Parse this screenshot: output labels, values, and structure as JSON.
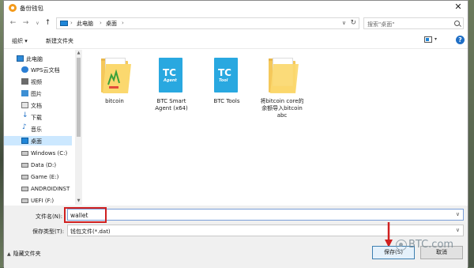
{
  "window": {
    "title": "备份钱包",
    "close_label": "✕"
  },
  "nav": {
    "breadcrumb": [
      "此电脑",
      "桌面"
    ],
    "search_placeholder": "搜索\"桌面\""
  },
  "toolbar": {
    "organize_label": "组织 ▾",
    "new_folder_label": "新建文件夹"
  },
  "sidebar": {
    "items": [
      {
        "label": "此电脑",
        "icon": "computer-icon"
      },
      {
        "label": "WPS云文档",
        "icon": "cloud-icon"
      },
      {
        "label": "视频",
        "icon": "video-icon"
      },
      {
        "label": "图片",
        "icon": "picture-icon"
      },
      {
        "label": "文档",
        "icon": "document-icon"
      },
      {
        "label": "下载",
        "icon": "download-icon"
      },
      {
        "label": "音乐",
        "icon": "music-icon"
      },
      {
        "label": "桌面",
        "icon": "desktop-icon"
      },
      {
        "label": "Windows (C:)",
        "icon": "drive-icon"
      },
      {
        "label": "Data (D:)",
        "icon": "drive-icon"
      },
      {
        "label": "Game (E:)",
        "icon": "drive-icon"
      },
      {
        "label": "ANDROIDINST",
        "icon": "drive-icon"
      },
      {
        "label": "UEFI (F:)",
        "icon": "drive-icon"
      }
    ]
  },
  "files": [
    {
      "name": "bitcoin",
      "icon": "bitcoin-folder-icon"
    },
    {
      "name": "BTC Smart\nAgent (x64)",
      "icon": "tc-book-icon",
      "badge": "TC",
      "sub": "Agent"
    },
    {
      "name": "BTC Tools",
      "icon": "tc-book-icon",
      "badge": "TC",
      "sub": "Tool"
    },
    {
      "name": "将bitcoin core的\n余额导入bitcoin\nabc",
      "icon": "document-folder-icon"
    }
  ],
  "form": {
    "filename_label": "文件名(N):",
    "filename_value": "wallet",
    "filetype_label": "保存类型(T):",
    "filetype_value": "钱包文件(*.dat)",
    "hide_folders_label": "隐藏文件夹",
    "save_label": "保存(S)",
    "cancel_label": "取消"
  },
  "watermark": {
    "text": "BTC.com"
  },
  "colors": {
    "accent": "#1f86d8",
    "highlight_red": "#d02020",
    "selected_bg": "#cce8ff"
  }
}
